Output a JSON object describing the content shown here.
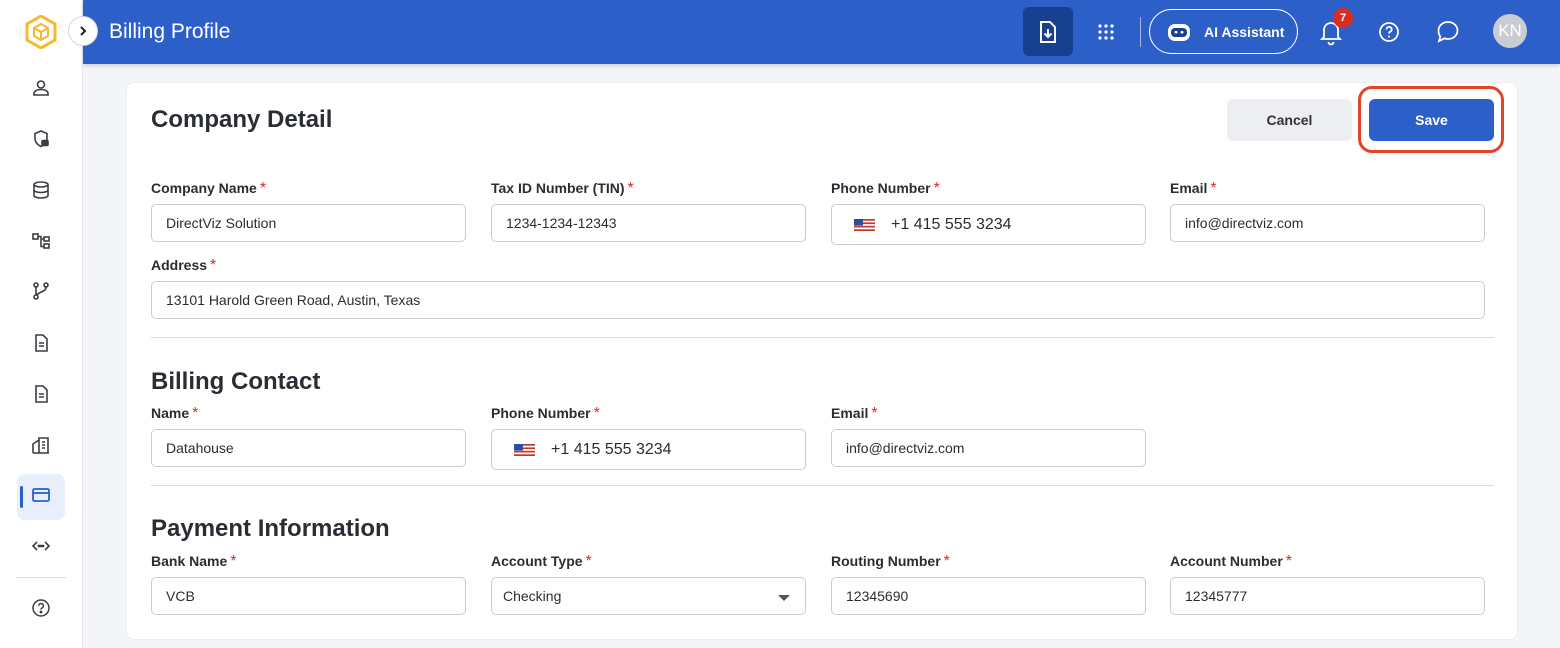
{
  "header": {
    "title": "Billing Profile",
    "ai_label": "AI Assistant",
    "notification_count": "7",
    "avatar_initials": "KN"
  },
  "sidebar": {
    "items": [
      {
        "icon": "user-icon"
      },
      {
        "icon": "shield-lock-icon"
      },
      {
        "icon": "database-icon"
      },
      {
        "icon": "hierarchy-icon"
      },
      {
        "icon": "git-merge-icon"
      },
      {
        "icon": "document-icon"
      },
      {
        "icon": "report-icon"
      },
      {
        "icon": "buildings-icon"
      },
      {
        "icon": "credit-card-icon",
        "active": true
      },
      {
        "icon": "api-icon"
      }
    ],
    "footer_icon": "help-icon"
  },
  "actions": {
    "cancel_label": "Cancel",
    "save_label": "Save"
  },
  "company": {
    "section_title": "Company Detail",
    "company_name_label": "Company Name",
    "company_name_value": "DirectViz Solution",
    "tax_id_label": "Tax ID Number (TIN)",
    "tax_id_value": "1234-1234-12343",
    "phone_label": "Phone Number",
    "phone_value": "+1 415 555 3234",
    "email_label": "Email",
    "email_value": "info@directviz.com",
    "address_label": "Address",
    "address_value": "13101 Harold Green Road, Austin, Texas"
  },
  "billing_contact": {
    "section_title": "Billing Contact",
    "name_label": "Name",
    "name_value": "Datahouse",
    "phone_label": "Phone Number",
    "phone_value": "+1 415 555 3234",
    "email_label": "Email",
    "email_value": "info@directviz.com"
  },
  "payment": {
    "section_title": "Payment Information",
    "bank_name_label": "Bank Name",
    "bank_name_value": "VCB",
    "account_type_label": "Account Type",
    "account_type_value": "Checking",
    "routing_label": "Routing Number",
    "routing_value": "12345690",
    "account_number_label": "Account Number",
    "account_number_value": "12345777"
  },
  "colors": {
    "primary": "#2d5fc9",
    "primary_dark": "#17408f",
    "required": "#d92d20",
    "highlight_ring": "#e2442a"
  }
}
